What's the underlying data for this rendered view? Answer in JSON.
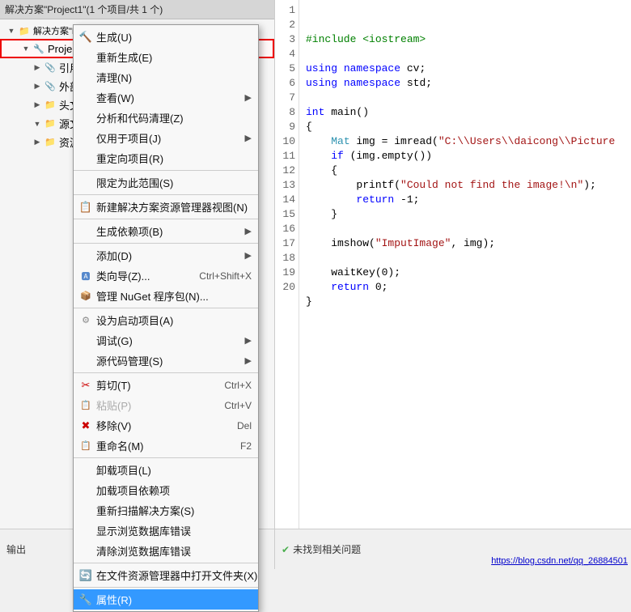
{
  "solution_header": {
    "text": "解决方案\"Project1\"(1 个项目/共 1 个)"
  },
  "tree": {
    "items": [
      {
        "id": "solution",
        "label": "解决方案\"Project1\"(1 个项目/共 1 个)",
        "indent": 0,
        "icon": "📁",
        "expanded": true
      },
      {
        "id": "project1",
        "label": "Project1",
        "indent": 1,
        "icon": "⚙",
        "expanded": true,
        "highlighted": true
      },
      {
        "id": "references",
        "label": "引用",
        "indent": 2,
        "icon": "📎"
      },
      {
        "id": "external_deps",
        "label": "外部依赖项",
        "indent": 2,
        "icon": "📎"
      },
      {
        "id": "header_files",
        "label": "头文件",
        "indent": 2,
        "icon": "📁"
      },
      {
        "id": "source_files",
        "label": "源文件",
        "indent": 2,
        "icon": "📁",
        "expanded": true
      },
      {
        "id": "resources",
        "label": "资源文件",
        "indent": 2,
        "icon": "📁"
      }
    ]
  },
  "context_menu": {
    "items": [
      {
        "id": "build",
        "label": "生成(U)",
        "icon": "🔨",
        "separator_after": false
      },
      {
        "id": "rebuild",
        "label": "重新生成(E)",
        "separator_after": false
      },
      {
        "id": "clean",
        "label": "清理(N)",
        "separator_after": false
      },
      {
        "id": "view",
        "label": "查看(W)",
        "has_submenu": true,
        "separator_after": false
      },
      {
        "id": "analyze",
        "label": "分析和代码清理(Z)",
        "separator_after": false
      },
      {
        "id": "project_only",
        "label": "仅用于项目(J)",
        "has_submenu": true,
        "separator_after": false
      },
      {
        "id": "retarget",
        "label": "重定向项目(R)",
        "separator_after": false
      },
      {
        "id": "scope",
        "label": "限定为此范围(S)",
        "separator_after": true
      },
      {
        "id": "new_solution_view",
        "label": "新建解决方案资源管理器视图(N)",
        "icon": "📋",
        "separator_after": false
      },
      {
        "id": "build_deps",
        "label": "生成依赖项(B)",
        "has_submenu": true,
        "separator_after": true
      },
      {
        "id": "add",
        "label": "添加(D)",
        "has_submenu": true,
        "separator_after": false
      },
      {
        "id": "class_wizard",
        "label": "类向导(Z)...",
        "icon": "🅰",
        "shortcut": "Ctrl+Shift+X",
        "separator_after": false
      },
      {
        "id": "manage_nuget",
        "label": "管理 NuGet 程序包(N)...",
        "icon": "📦",
        "separator_after": true
      },
      {
        "id": "set_startup",
        "label": "设为启动项目(A)",
        "icon": "⚙",
        "separator_after": false
      },
      {
        "id": "debug",
        "label": "调试(G)",
        "has_submenu": true,
        "separator_after": false
      },
      {
        "id": "source_control",
        "label": "源代码管理(S)",
        "has_submenu": true,
        "separator_after": true
      },
      {
        "id": "cut",
        "label": "剪切(T)",
        "icon": "✂",
        "shortcut": "Ctrl+X",
        "separator_after": false
      },
      {
        "id": "paste",
        "label": "粘贴(P)",
        "icon": "📋",
        "shortcut": "Ctrl+V",
        "disabled": true,
        "separator_after": false
      },
      {
        "id": "remove",
        "label": "移除(V)",
        "icon": "✖",
        "shortcut": "Del",
        "separator_after": false
      },
      {
        "id": "rename",
        "label": "重命名(M)",
        "icon": "📋",
        "shortcut": "F2",
        "separator_after": true
      },
      {
        "id": "unload",
        "label": "卸载项目(L)",
        "separator_after": false
      },
      {
        "id": "load_project_deps",
        "label": "加载项目依赖项",
        "separator_after": false
      },
      {
        "id": "rescan",
        "label": "重新扫描解决方案(S)",
        "separator_after": false
      },
      {
        "id": "show_browser_errors",
        "label": "显示浏览数据库错误",
        "separator_after": false
      },
      {
        "id": "clear_browser_errors",
        "label": "清除浏览数据库错误",
        "separator_after": true
      },
      {
        "id": "open_in_explorer",
        "label": "在文件资源管理器中打开文件夹(X)",
        "icon": "🔄",
        "separator_after": true
      },
      {
        "id": "properties",
        "label": "属性(R)",
        "icon": "🔧",
        "highlighted": true
      }
    ]
  },
  "code": {
    "lines": [
      {
        "num": 1,
        "content": "",
        "html": ""
      },
      {
        "num": 2,
        "content": "",
        "html": "<span class='code-comment'>#include &lt;iostream&gt;</span>"
      },
      {
        "num": 3,
        "content": "",
        "html": ""
      },
      {
        "num": 4,
        "content": "",
        "html": "<span class='kw-using'>using</span> <span class='kw-namespace'>namespace</span> cv;"
      },
      {
        "num": 5,
        "content": "",
        "html": "<span class='kw-using'>using</span> <span class='kw-namespace'>namespace</span> std;"
      },
      {
        "num": 6,
        "content": "",
        "html": ""
      },
      {
        "num": 7,
        "content": "",
        "html": "<span class='kw-int'>int</span> main()"
      },
      {
        "num": 8,
        "content": "",
        "html": "{"
      },
      {
        "num": 9,
        "content": "",
        "html": "    <span class='code-type'>Mat</span> img = imread(<span class='code-string'>\"C:\\\\Users\\\\daicong\\\\Picture</span>"
      },
      {
        "num": 10,
        "content": "",
        "html": "    <span class='kw-if'>if</span> (img.empty())"
      },
      {
        "num": 11,
        "content": "",
        "html": "    {"
      },
      {
        "num": 12,
        "content": "",
        "html": "        printf(<span class='code-string'>\"Could not find the image!\\n\"</span>);"
      },
      {
        "num": 13,
        "content": "",
        "html": "        <span class='kw-return'>return</span> -1;"
      },
      {
        "num": 14,
        "content": "",
        "html": "    }"
      },
      {
        "num": 15,
        "content": "",
        "html": ""
      },
      {
        "num": 16,
        "content": "",
        "html": "    imshow(<span class='code-string'>\"ImputImage\"</span>, img);"
      },
      {
        "num": 17,
        "content": "",
        "html": ""
      },
      {
        "num": 18,
        "content": "",
        "html": "    waitKey(0);"
      },
      {
        "num": 19,
        "content": "",
        "html": "    <span class='kw-return'>return</span> 0;"
      },
      {
        "num": 20,
        "content": "",
        "html": "}"
      }
    ]
  },
  "status_bar": {
    "no_issues": "未找到相关问题",
    "blog_url": "https://blog.csdn.net/qq_26884501"
  },
  "bottom_tabs": {
    "active": "输出",
    "items": [
      "输出"
    ]
  }
}
